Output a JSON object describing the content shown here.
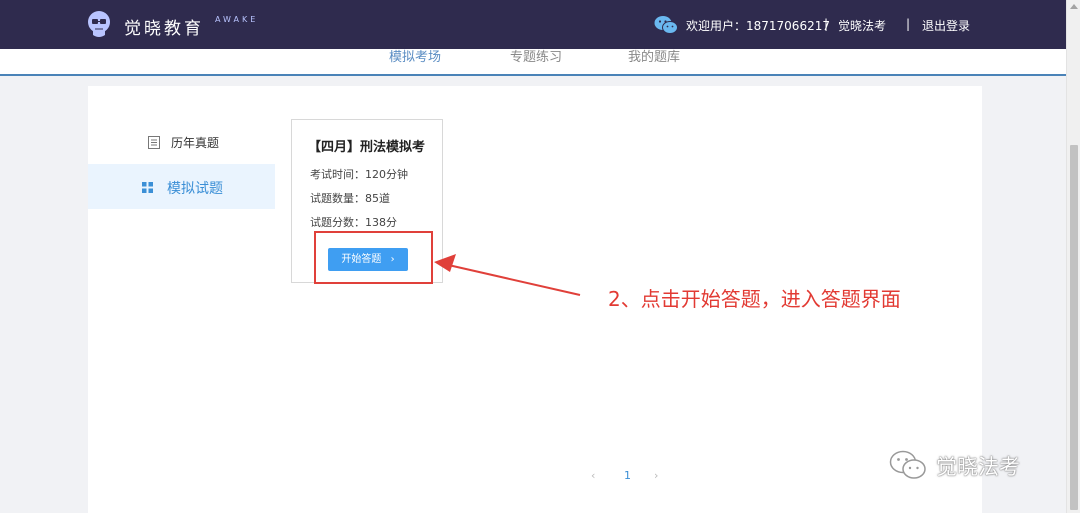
{
  "header": {
    "brand": "觉晓教育",
    "brand_sub": "AWAKE",
    "welcome": "欢迎用户：18717066217",
    "sep1": "|",
    "link_exam": "觉晓法考",
    "sep2": "|",
    "link_logout": "退出登录",
    "bg_color": "#2f2b4e"
  },
  "tabs": [
    {
      "label": "模拟考场",
      "active": true
    },
    {
      "label": "专题练习",
      "active": false
    },
    {
      "label": "我的题库",
      "active": false
    }
  ],
  "sidebar": {
    "items": [
      {
        "label": "历年真题",
        "icon": "document-icon",
        "active": false
      },
      {
        "label": "模拟试题",
        "icon": "grid-icon",
        "active": true
      }
    ]
  },
  "card": {
    "title": "【四月】刑法模拟考",
    "time_label": "考试时间：",
    "time_value": "120分钟",
    "count_label": "试题数量：",
    "count_value": "85道",
    "score_label": "试题分数：",
    "score_value": "138分",
    "start_button": "开始答题",
    "start_chevron": "›"
  },
  "annotation": {
    "text": "2、点击开始答题，进入答题界面",
    "color": "#e23a33"
  },
  "pagination": {
    "prev": "‹",
    "current": "1",
    "next": "›"
  },
  "watermark": {
    "text": "觉晓法考"
  }
}
